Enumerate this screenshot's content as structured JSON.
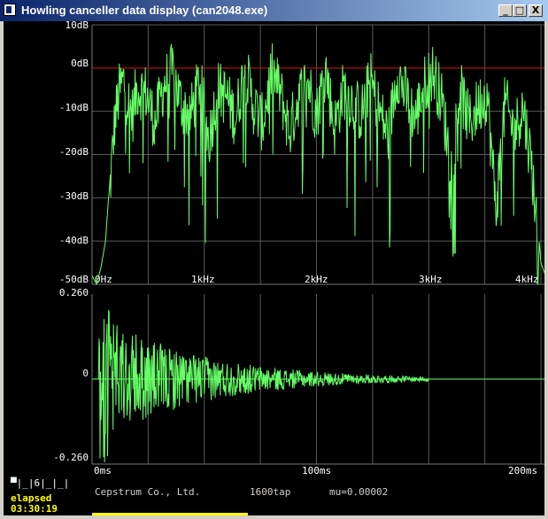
{
  "window": {
    "title": "Howling canceller data display (can2048.exe)"
  },
  "title_buttons": {
    "minimize": "_",
    "maximize": "□",
    "close": "X"
  },
  "spectrum": {
    "y_labels": [
      "10dB",
      "0dB",
      "-10dB",
      "-20dB",
      "-30dB",
      "-40dB",
      "-50dB"
    ],
    "x_labels": [
      "0Hz",
      "1kHz",
      "2kHz",
      "3kHz",
      "4kHz"
    ],
    "reference_line": "0dB"
  },
  "impulse": {
    "y_labels": [
      "0.260",
      "0",
      "-0.260"
    ],
    "x_labels": [
      "0ms",
      "100ms",
      "200ms"
    ]
  },
  "status": {
    "company": "Cepstrum Co., Ltd.",
    "taps": "1600tap",
    "mu": "mu=0.00002"
  },
  "controls": {
    "strip": "▀|_|6|_|_|"
  },
  "elapsed": {
    "label": "elapsed",
    "time": "03:30:19"
  },
  "colors": {
    "trace": "#66ff66",
    "grid": "#5a5a5a",
    "reference": "#cc0000",
    "text": "#ffffff",
    "status_yellow": "#ffff00"
  },
  "chart_data": [
    {
      "type": "line",
      "title": "",
      "xlabel": "",
      "ylabel": "",
      "xlim": [
        0,
        4000
      ],
      "ylim": [
        -50,
        10
      ],
      "x_unit": "Hz",
      "y_unit": "dB",
      "series": [
        {
          "x": [
            0,
            40,
            80,
            120,
            160,
            200,
            240,
            280,
            320,
            360,
            400,
            480,
            560,
            640,
            720,
            800,
            880,
            960,
            1040,
            1120,
            1200,
            1280,
            1360,
            1440,
            1520,
            1600,
            1680,
            1760,
            1840,
            1920,
            2000,
            2080,
            2160,
            2240,
            2320,
            2400,
            2480,
            2560,
            2640,
            2720,
            2800,
            2880,
            2960,
            3040,
            3120,
            3200,
            3280,
            3360,
            3440,
            3520,
            3600,
            3680,
            3760,
            3840,
            3920,
            4000,
            4040
          ],
          "y": [
            -48,
            -50,
            -46,
            -40,
            -25,
            -10,
            -3,
            0,
            -5,
            -8,
            -2,
            -3,
            -10,
            -1,
            2,
            -6,
            -8,
            0,
            -14,
            -2,
            -4,
            -9,
            3,
            -6,
            -10,
            2,
            -3,
            -12,
            -4,
            0,
            -8,
            3,
            -11,
            -2,
            -5,
            -8,
            0,
            -7,
            -13,
            2,
            -4,
            -9,
            -1,
            2,
            -5,
            -20,
            -2,
            -10,
            -6,
            -3,
            -30,
            -5,
            -12,
            -6,
            -20,
            -45,
            -48
          ]
        }
      ]
    },
    {
      "type": "line",
      "title": "",
      "xlabel": "",
      "ylabel": "",
      "xlim": [
        0,
        200
      ],
      "ylim": [
        -0.26,
        0.26
      ],
      "x_unit": "ms",
      "envelope_peak": 0.2,
      "envelope_decay_ms": 45,
      "active_until_ms": 150
    }
  ]
}
